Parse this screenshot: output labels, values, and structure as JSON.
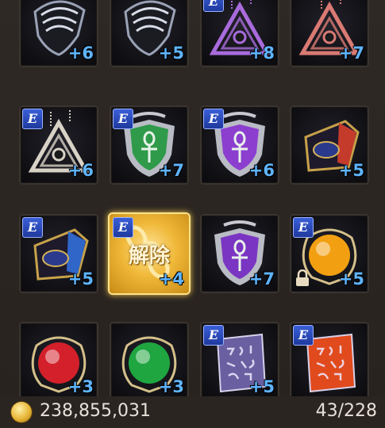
{
  "inventory": {
    "unlock_label": "解除",
    "e_badge": "E",
    "slots": [
      {
        "icon": "winged-helm-icon",
        "enhance": "+6",
        "e": false,
        "color": "#9aa2b6"
      },
      {
        "icon": "winged-helm-icon",
        "enhance": "+5",
        "e": false,
        "color": "#9aa2b6"
      },
      {
        "icon": "pendant-earring-icon",
        "enhance": "+8",
        "e": true,
        "color": "#a86bdc"
      },
      {
        "icon": "pendant-earring-icon",
        "enhance": "+7",
        "e": false,
        "color": "#d97a73"
      },
      {
        "icon": "pendant-earring-icon",
        "enhance": "+6",
        "e": true,
        "color": "#d8d2c6"
      },
      {
        "icon": "ankh-shield-icon",
        "enhance": "+7",
        "e": true,
        "color": "#2f9a4a"
      },
      {
        "icon": "ankh-shield-icon",
        "enhance": "+6",
        "e": true,
        "color": "#8c3fcf"
      },
      {
        "icon": "bracer-icon",
        "enhance": "+5",
        "e": false,
        "color": "#c43b2c"
      },
      {
        "icon": "bracer-icon",
        "enhance": "+5",
        "e": true,
        "color": "#2f66c8"
      },
      {
        "icon": "gold-chain-icon",
        "enhance": "+4",
        "e": true,
        "color": "#e2a21b",
        "selected": true
      },
      {
        "icon": "ankh-shield-icon",
        "enhance": "+7",
        "e": false,
        "color": "#7a35c2"
      },
      {
        "icon": "orb-icon",
        "enhance": "+5",
        "e": true,
        "color": "#f2a012",
        "locked": true
      },
      {
        "icon": "orb-icon",
        "enhance": "+3",
        "e": false,
        "color": "#d3202a"
      },
      {
        "icon": "orb-icon",
        "enhance": "+3",
        "e": false,
        "color": "#1fa640"
      },
      {
        "icon": "rune-tablet-icon",
        "enhance": "+5",
        "e": true,
        "color": "#6a5fa0"
      },
      {
        "icon": "rune-tablet-icon",
        "enhance": "",
        "e": true,
        "color": "#e04a1c"
      }
    ]
  },
  "footer": {
    "gold_amount": "238,855,031",
    "capacity": "43/228"
  }
}
